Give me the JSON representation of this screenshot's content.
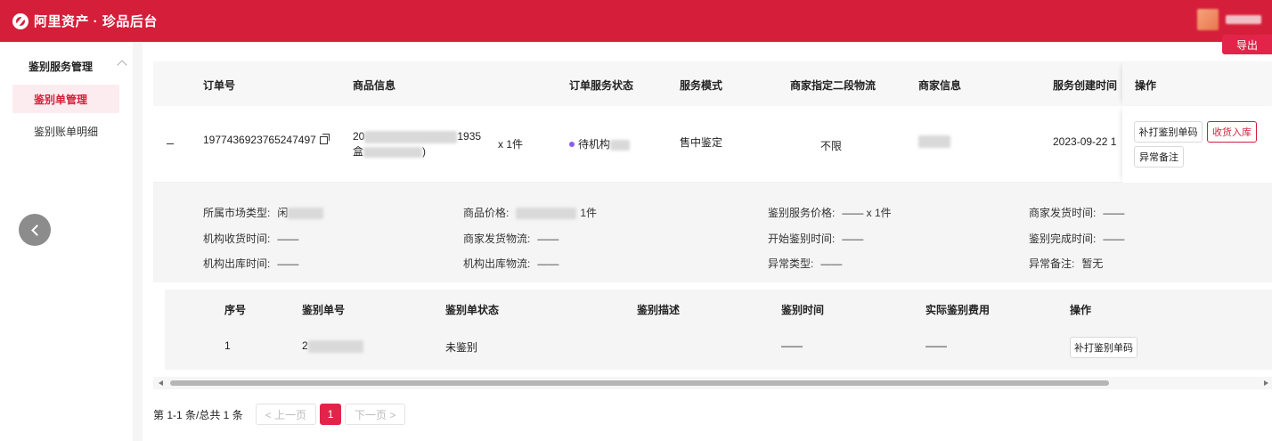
{
  "header": {
    "app_title": "阿里资产 · 珍品后台",
    "brand_color": "#d51f3a"
  },
  "sidebar": {
    "group_label": "鉴别服务管理",
    "items": [
      {
        "label": "鉴别单管理",
        "active": true
      },
      {
        "label": "鉴别账单明细",
        "active": false
      }
    ]
  },
  "toolbar": {
    "export_label": "导出"
  },
  "table": {
    "columns": [
      "订单号",
      "商品信息",
      "订单服务状态",
      "服务模式",
      "商家指定二段物流",
      "商家信息",
      "服务创建时间",
      "操作"
    ],
    "row": {
      "expand_toggle": "–",
      "order_no": "1977436923765247497",
      "product_prefix": "20",
      "product_suffix": "1935",
      "product_line2_prefix": "盒",
      "product_line2_suffix": ")",
      "quantity": "x 1件",
      "status": "待机构",
      "status_color": "#8e5bf0",
      "service_mode": "售中鉴定",
      "logistics": "不限",
      "created_time": "2023-09-22 1",
      "actions": {
        "reprint": "补打鉴别单码",
        "receive": "收货入库",
        "exception_note": "异常备注"
      }
    }
  },
  "detail": {
    "market_type_label": "所属市场类型:",
    "market_type_value": "闲",
    "price_label": "商品价格:",
    "price_suffix": "1件",
    "service_price_label": "鉴别服务价格:",
    "service_price_value": "—— x 1件",
    "merchant_ship_time_label": "商家发货时间:",
    "merchant_ship_time_value": "——",
    "agency_receive_time_label": "机构收货时间:",
    "agency_receive_time_value": "——",
    "merchant_logistics_label": "商家发货物流:",
    "merchant_logistics_value": "——",
    "start_time_label": "开始鉴别时间:",
    "start_time_value": "——",
    "finish_time_label": "鉴别完成时间:",
    "finish_time_value": "——",
    "agency_out_time_label": "机构出库时间:",
    "agency_out_time_value": "——",
    "agency_out_logistics_label": "机构出库物流:",
    "agency_out_logistics_value": "——",
    "exception_type_label": "异常类型:",
    "exception_type_value": "——",
    "exception_note_label": "异常备注:",
    "exception_note_value": "暂无"
  },
  "sub_table": {
    "columns": [
      "序号",
      "鉴别单号",
      "鉴别单状态",
      "鉴别描述",
      "鉴别时间",
      "实际鉴别费用",
      "操作"
    ],
    "row": {
      "index": "1",
      "code_prefix": "2",
      "status": "未鉴别",
      "description": "",
      "time": "——",
      "fee": "——",
      "action": "补打鉴别单码"
    }
  },
  "pagination": {
    "summary": "第 1-1 条/总共 1 条",
    "prev": "< 上一页",
    "current": "1",
    "next": "下一页 >"
  }
}
